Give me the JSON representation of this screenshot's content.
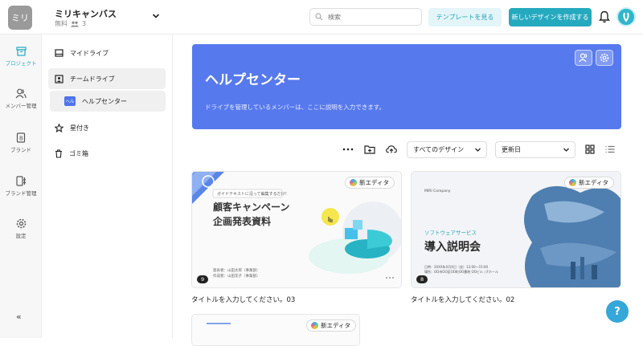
{
  "app": {
    "logo_text": "ミリ",
    "workspace_name": "ミリキャンバス",
    "plan": "無料",
    "member_count": "3"
  },
  "header": {
    "search_placeholder": "検索",
    "template_button": "テンプレートを見る",
    "new_design_button": "新しいデザインを作成する"
  },
  "rail": {
    "items": [
      {
        "label": "プロジェクト",
        "icon": "archive-icon"
      },
      {
        "label": "メンバー管理",
        "icon": "users-icon"
      },
      {
        "label": "ブランド",
        "icon": "brand-icon"
      },
      {
        "label": "ブランド管理",
        "icon": "brand-manage-icon"
      },
      {
        "label": "設定",
        "icon": "gear-icon"
      }
    ],
    "collapse": "«"
  },
  "sidebar": {
    "items": [
      {
        "label": "マイドライブ"
      },
      {
        "label": "チームドライブ"
      },
      {
        "label": "ヘルプセンター",
        "tag": "ヘル"
      },
      {
        "label": "星付き"
      },
      {
        "label": "ゴミ箱"
      }
    ]
  },
  "hero": {
    "title": "ヘルプセンター",
    "description": "ドライブを管理しているメンバーは、ここに説明を入力できます。"
  },
  "toolbar": {
    "filter_select": "すべてのデザイン",
    "sort_select": "更新日"
  },
  "cards": [
    {
      "badge": "新エディタ",
      "count": "9",
      "title": "タイトルを入力してください。03",
      "thumb": {
        "label": "ガイドテキストに沿って編集するだけ！",
        "heading1": "顧客キャンペーン",
        "heading2": "企画発表資料",
        "meta1": "発表者：山田太郎（事業部）",
        "meta2": "作成者：山田花子（事業部）"
      }
    },
    {
      "badge": "新エディタ",
      "count": "8",
      "title": "タイトルを入力してください。02",
      "thumb": {
        "company": "MIRI Company",
        "kicker": "ソフトウェアサービス",
        "heading": "導入説明会",
        "meta1": "日時：20XX年X月X日（金）13:00〜15:00",
        "meta2": "場所：OO市OO区OO町OO番地 OOビル ○Fホール"
      }
    },
    {
      "badge": "新エディタ"
    }
  ],
  "help": {
    "label": "?"
  },
  "colors": {
    "accent": "#25a9bf",
    "hero": "#5779ee"
  }
}
